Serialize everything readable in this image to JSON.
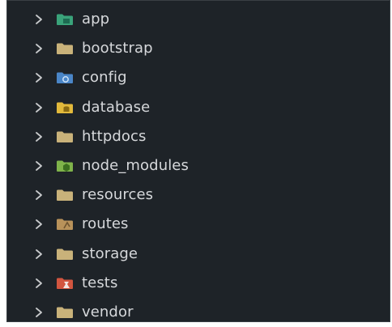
{
  "explorer": {
    "items": [
      {
        "label": "app",
        "icon": "folder-app-icon",
        "color": "#3aa37a"
      },
      {
        "label": "bootstrap",
        "icon": "folder-icon",
        "color": "#c9b27a"
      },
      {
        "label": "config",
        "icon": "folder-config-icon",
        "color": "#4a86c8"
      },
      {
        "label": "database",
        "icon": "folder-database-icon",
        "color": "#e2b93b"
      },
      {
        "label": "httpdocs",
        "icon": "folder-icon",
        "color": "#c9b27a"
      },
      {
        "label": "node_modules",
        "icon": "folder-node-icon",
        "color": "#7fb34a"
      },
      {
        "label": "resources",
        "icon": "folder-icon",
        "color": "#c9b27a"
      },
      {
        "label": "routes",
        "icon": "folder-routes-icon",
        "color": "#b9925a"
      },
      {
        "label": "storage",
        "icon": "folder-icon",
        "color": "#c9b27a"
      },
      {
        "label": "tests",
        "icon": "folder-tests-icon",
        "color": "#d2553f"
      },
      {
        "label": "vendor",
        "icon": "folder-icon",
        "color": "#c9b27a"
      }
    ]
  }
}
